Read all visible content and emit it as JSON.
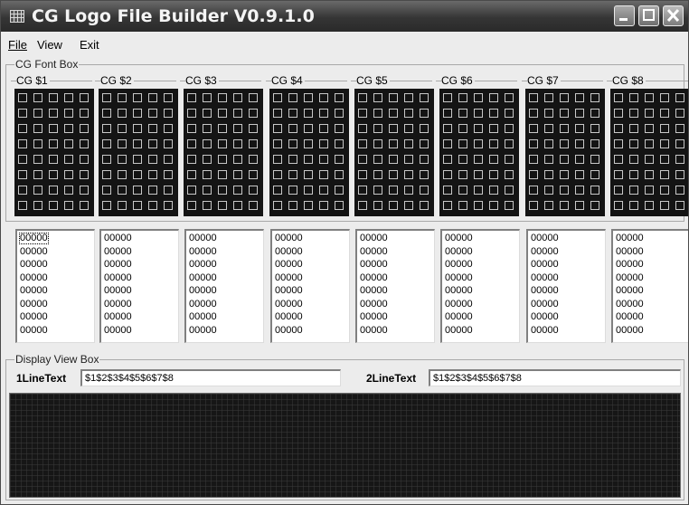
{
  "window": {
    "title": "CG Logo File Builder V0.9.1.0"
  },
  "menu": [
    {
      "label": "File"
    },
    {
      "label": "View"
    },
    {
      "label": "Exit"
    }
  ],
  "cg_font_box": {
    "label": "CG Font Box"
  },
  "cg_panels": [
    {
      "label": "CG $1"
    },
    {
      "label": "CG $2"
    },
    {
      "label": "CG $3"
    },
    {
      "label": "CG $4"
    },
    {
      "label": "CG $5"
    },
    {
      "label": "CG $6"
    },
    {
      "label": "CG $7"
    },
    {
      "label": "CG $8"
    }
  ],
  "hex_rows": [
    "00000",
    "00000",
    "00000",
    "00000",
    "00000",
    "00000",
    "00000",
    "00000"
  ],
  "display_view_box": {
    "label": "Display View Box",
    "line1_label": "1LineText",
    "line1_value": "$1$2$3$4$5$6$7$8",
    "line2_label": "2LineText",
    "line2_value": "$1$2$3$4$5$6$7$8"
  },
  "icons": {
    "app": "grid-app-icon",
    "minimize": "minimize-icon",
    "maximize": "maximize-icon",
    "close": "close-icon"
  }
}
